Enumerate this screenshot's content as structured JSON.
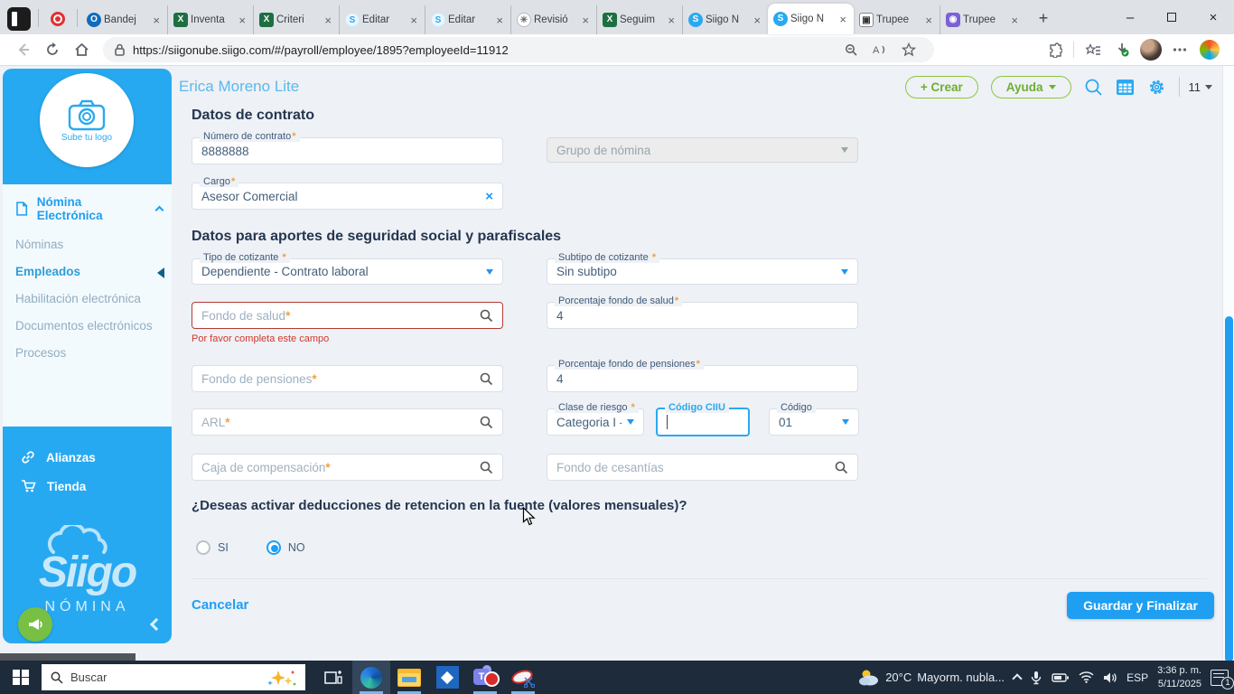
{
  "browser": {
    "tabs": [
      {
        "title": "Bandej",
        "icon": "outlook"
      },
      {
        "title": "Inventa",
        "icon": "excel"
      },
      {
        "title": "Criteri",
        "icon": "excel"
      },
      {
        "title": "Editar",
        "icon": "siigo-light"
      },
      {
        "title": "Editar",
        "icon": "siigo-light"
      },
      {
        "title": "Revisió",
        "icon": "gpt"
      },
      {
        "title": "Seguim",
        "icon": "excel"
      },
      {
        "title": "Siigo N",
        "icon": "siigo-blue"
      },
      {
        "title": "Siigo N",
        "icon": "siigo-blue",
        "active": true
      },
      {
        "title": "Trupee",
        "icon": "trupee-light"
      },
      {
        "title": "Trupee",
        "icon": "trupee-purple"
      }
    ],
    "close_glyph": "×",
    "new_tab_glyph": "+",
    "url": "https://siigonube.siigo.com/#/payroll/employee/1895?employeeId=11912"
  },
  "sidebar": {
    "upload_logo": "Sube tu logo",
    "menu_header": "Nómina Electrónica",
    "items": [
      {
        "label": "Nóminas"
      },
      {
        "label": "Empleados",
        "active": true
      },
      {
        "label": "Habilitación electrónica"
      },
      {
        "label": "Documentos electrónicos"
      },
      {
        "label": "Procesos"
      }
    ],
    "links": [
      {
        "label": "Alianzas"
      },
      {
        "label": "Tienda"
      }
    ],
    "brand": "Siigo",
    "brand_sub": "NÓMINA"
  },
  "header": {
    "title": "Erica Moreno Lite",
    "crear": "+ Crear",
    "ayuda": "Ayuda",
    "count": "11"
  },
  "form": {
    "section_contract": {
      "title": "Datos de contrato",
      "numero": {
        "label": "Número de contrato",
        "value": "8888888"
      },
      "grupo": {
        "label": "Grupo de nómina"
      },
      "cargo": {
        "label": "Cargo",
        "value": "Asesor Comercial"
      }
    },
    "section_social": {
      "title": "Datos para aportes de seguridad social y parafiscales",
      "tipo": {
        "label": "Tipo de cotizante",
        "value": "Dependiente - Contrato laboral"
      },
      "subtipo": {
        "label": "Subtipo de cotizante",
        "value": "Sin subtipo"
      },
      "fondo_salud": {
        "placeholder": "Fondo de salud",
        "error": "Por favor completa este campo"
      },
      "pct_salud": {
        "label": "Porcentaje fondo de salud",
        "value": "4"
      },
      "fondo_pensiones": {
        "placeholder": "Fondo de pensiones"
      },
      "pct_pensiones": {
        "label": "Porcentaje fondo de pensiones",
        "value": "4"
      },
      "arl": {
        "placeholder": "ARL"
      },
      "clase_riesgo": {
        "label": "Clase de riesgo",
        "value": "Categoria I -..."
      },
      "codigo_ciiu": {
        "label": "Código CIIU",
        "value": ""
      },
      "codigo": {
        "label": "Código",
        "value": "01"
      },
      "caja": {
        "placeholder": "Caja de compensación"
      },
      "cesantias": {
        "placeholder": "Fondo de cesantías"
      }
    },
    "question": "¿Deseas activar deducciones de retencion en la fuente (valores mensuales)?",
    "radio_si": "SI",
    "radio_no": "NO",
    "cancel": "Cancelar",
    "save": "Guardar y Finalizar"
  },
  "taskbar": {
    "search_placeholder": "Buscar",
    "temp": "20°C",
    "weather_desc": "Mayorm. nubla...",
    "lang": "ESP",
    "time": "3:36 p. m.",
    "date": "5/11/2025",
    "notif_badge": "1"
  },
  "colors": {
    "accent_blue": "#1e9ff2",
    "sidebar_blue": "#27a9f1",
    "green_outline": "#8cc63e",
    "error_red": "#b23c33",
    "taskbar_dark": "#1d2b3b"
  },
  "icons": {
    "record": "●",
    "search": "⌕",
    "calendar": "▦",
    "gear": "⚙",
    "camera": "📷",
    "link": "∞",
    "cart": "▥",
    "megaphone": "📢",
    "lock": "🔒"
  }
}
